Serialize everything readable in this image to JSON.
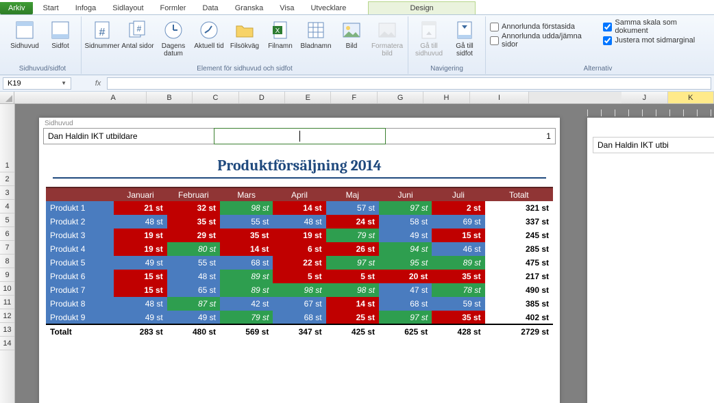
{
  "tabs": {
    "file": "Arkiv",
    "list": [
      "Start",
      "Infoga",
      "Sidlayout",
      "Formler",
      "Data",
      "Granska",
      "Visa",
      "Utvecklare"
    ],
    "contextual": "Design"
  },
  "ribbon": {
    "g1": {
      "label": "Sidhuvud/sidfot",
      "header": "Sidhuvud",
      "footer": "Sidfot"
    },
    "g2": {
      "label": "Element för sidhuvud och sidfot",
      "pagenum": "Sidnummer",
      "pages": "Antal\nsidor",
      "date": "Dagens\ndatum",
      "time": "Aktuell\ntid",
      "path": "Filsökväg",
      "filename": "Filnamn",
      "sheetname": "Bladnamn",
      "picture": "Bild",
      "fmtpic": "Formatera\nbild"
    },
    "g3": {
      "label": "Navigering",
      "gohdr": "Gå till\nsidhuvud",
      "goftr": "Gå till\nsidfot"
    },
    "g4": {
      "label": "Alternativ",
      "diff_first": "Annorlunda förstasida",
      "diff_odd": "Annorlunda udda/jämna sidor",
      "scale": "Samma skala som dokument",
      "align": "Justera mot sidmarginal"
    }
  },
  "namebox": "K19",
  "cols": [
    "A",
    "B",
    "C",
    "D",
    "E",
    "F",
    "G",
    "H",
    "I",
    "J",
    "K"
  ],
  "rows": [
    "1",
    "2",
    "3",
    "4",
    "5",
    "6",
    "7",
    "8",
    "9",
    "10",
    "11",
    "12",
    "13",
    "14"
  ],
  "header": {
    "label": "Sidhuvud",
    "left": "Dan Haldin IKT utbildare",
    "right": "1",
    "side_left": "Dan Haldin IKT utbi"
  },
  "title": "Produktförsäljning 2014",
  "table": {
    "headers": [
      "",
      "Januari",
      "Februari",
      "Mars",
      "April",
      "Maj",
      "Juni",
      "Juli",
      "Totalt"
    ],
    "rows": [
      {
        "name": "Produkt 1",
        "vals": [
          "21 st",
          "32 st",
          "98 st",
          "14 st",
          "57 st",
          "97 st",
          "2 st"
        ],
        "cls": [
          "r",
          "r",
          "g",
          "r",
          "b",
          "g",
          "r"
        ],
        "tot": "321 st"
      },
      {
        "name": "Produkt 2",
        "vals": [
          "48 st",
          "35 st",
          "55 st",
          "48 st",
          "24 st",
          "58 st",
          "69 st"
        ],
        "cls": [
          "b",
          "r",
          "b",
          "b",
          "r",
          "b",
          "b"
        ],
        "tot": "337 st"
      },
      {
        "name": "Produkt 3",
        "vals": [
          "19 st",
          "29 st",
          "35 st",
          "19 st",
          "79 st",
          "49 st",
          "15 st"
        ],
        "cls": [
          "r",
          "r",
          "r",
          "r",
          "g",
          "b",
          "r"
        ],
        "tot": "245 st"
      },
      {
        "name": "Produkt 4",
        "vals": [
          "19 st",
          "80 st",
          "14 st",
          "6 st",
          "26 st",
          "94 st",
          "46 st"
        ],
        "cls": [
          "r",
          "g",
          "r",
          "r",
          "r",
          "g",
          "b"
        ],
        "tot": "285 st"
      },
      {
        "name": "Produkt 5",
        "vals": [
          "49 st",
          "55 st",
          "68 st",
          "22 st",
          "97 st",
          "95 st",
          "89 st"
        ],
        "cls": [
          "b",
          "b",
          "b",
          "r",
          "g",
          "g",
          "g"
        ],
        "tot": "475 st"
      },
      {
        "name": "Produkt 6",
        "vals": [
          "15 st",
          "48 st",
          "89 st",
          "5 st",
          "5 st",
          "20 st",
          "35 st"
        ],
        "cls": [
          "r",
          "b",
          "g",
          "r",
          "r",
          "r",
          "r"
        ],
        "tot": "217 st"
      },
      {
        "name": "Produkt 7",
        "vals": [
          "15 st",
          "65 st",
          "89 st",
          "98 st",
          "98 st",
          "47 st",
          "78 st"
        ],
        "cls": [
          "r",
          "b",
          "g",
          "g",
          "g",
          "b",
          "g"
        ],
        "tot": "490 st"
      },
      {
        "name": "Produkt 8",
        "vals": [
          "48 st",
          "87 st",
          "42 st",
          "67 st",
          "14 st",
          "68 st",
          "59 st"
        ],
        "cls": [
          "b",
          "g",
          "b",
          "b",
          "r",
          "b",
          "b"
        ],
        "tot": "385 st"
      },
      {
        "name": "Produkt 9",
        "vals": [
          "49 st",
          "49 st",
          "79 st",
          "68 st",
          "25 st",
          "97 st",
          "35 st"
        ],
        "cls": [
          "b",
          "b",
          "g",
          "b",
          "r",
          "g",
          "r"
        ],
        "tot": "402 st"
      }
    ],
    "footer": {
      "label": "Totalt",
      "vals": [
        "283 st",
        "480 st",
        "569 st",
        "347 st",
        "425 st",
        "625 st",
        "428 st",
        "2729 st"
      ]
    }
  }
}
